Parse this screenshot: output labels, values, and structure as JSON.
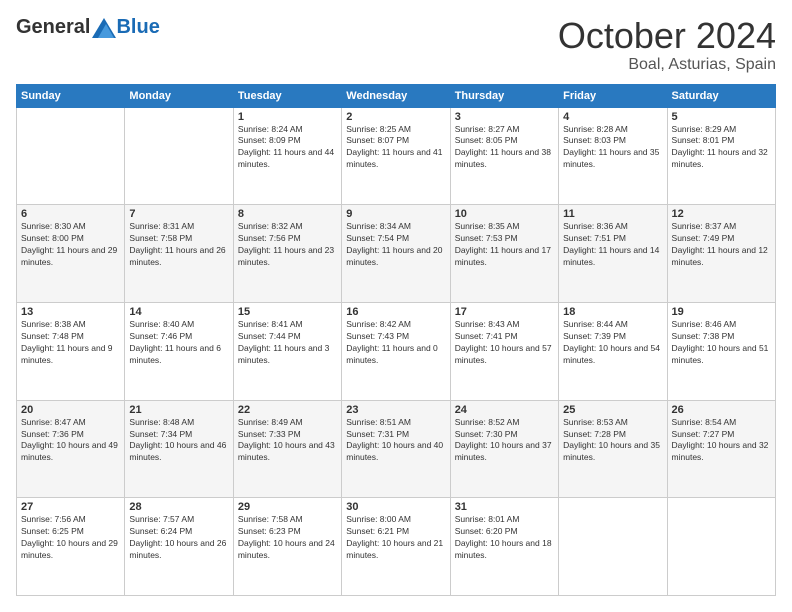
{
  "header": {
    "logo_general": "General",
    "logo_blue": "Blue",
    "month_title": "October 2024",
    "location": "Boal, Asturias, Spain"
  },
  "days_of_week": [
    "Sunday",
    "Monday",
    "Tuesday",
    "Wednesday",
    "Thursday",
    "Friday",
    "Saturday"
  ],
  "weeks": [
    [
      {
        "day": "",
        "info": ""
      },
      {
        "day": "",
        "info": ""
      },
      {
        "day": "1",
        "info": "Sunrise: 8:24 AM\nSunset: 8:09 PM\nDaylight: 11 hours and 44 minutes."
      },
      {
        "day": "2",
        "info": "Sunrise: 8:25 AM\nSunset: 8:07 PM\nDaylight: 11 hours and 41 minutes."
      },
      {
        "day": "3",
        "info": "Sunrise: 8:27 AM\nSunset: 8:05 PM\nDaylight: 11 hours and 38 minutes."
      },
      {
        "day": "4",
        "info": "Sunrise: 8:28 AM\nSunset: 8:03 PM\nDaylight: 11 hours and 35 minutes."
      },
      {
        "day": "5",
        "info": "Sunrise: 8:29 AM\nSunset: 8:01 PM\nDaylight: 11 hours and 32 minutes."
      }
    ],
    [
      {
        "day": "6",
        "info": "Sunrise: 8:30 AM\nSunset: 8:00 PM\nDaylight: 11 hours and 29 minutes."
      },
      {
        "day": "7",
        "info": "Sunrise: 8:31 AM\nSunset: 7:58 PM\nDaylight: 11 hours and 26 minutes."
      },
      {
        "day": "8",
        "info": "Sunrise: 8:32 AM\nSunset: 7:56 PM\nDaylight: 11 hours and 23 minutes."
      },
      {
        "day": "9",
        "info": "Sunrise: 8:34 AM\nSunset: 7:54 PM\nDaylight: 11 hours and 20 minutes."
      },
      {
        "day": "10",
        "info": "Sunrise: 8:35 AM\nSunset: 7:53 PM\nDaylight: 11 hours and 17 minutes."
      },
      {
        "day": "11",
        "info": "Sunrise: 8:36 AM\nSunset: 7:51 PM\nDaylight: 11 hours and 14 minutes."
      },
      {
        "day": "12",
        "info": "Sunrise: 8:37 AM\nSunset: 7:49 PM\nDaylight: 11 hours and 12 minutes."
      }
    ],
    [
      {
        "day": "13",
        "info": "Sunrise: 8:38 AM\nSunset: 7:48 PM\nDaylight: 11 hours and 9 minutes."
      },
      {
        "day": "14",
        "info": "Sunrise: 8:40 AM\nSunset: 7:46 PM\nDaylight: 11 hours and 6 minutes."
      },
      {
        "day": "15",
        "info": "Sunrise: 8:41 AM\nSunset: 7:44 PM\nDaylight: 11 hours and 3 minutes."
      },
      {
        "day": "16",
        "info": "Sunrise: 8:42 AM\nSunset: 7:43 PM\nDaylight: 11 hours and 0 minutes."
      },
      {
        "day": "17",
        "info": "Sunrise: 8:43 AM\nSunset: 7:41 PM\nDaylight: 10 hours and 57 minutes."
      },
      {
        "day": "18",
        "info": "Sunrise: 8:44 AM\nSunset: 7:39 PM\nDaylight: 10 hours and 54 minutes."
      },
      {
        "day": "19",
        "info": "Sunrise: 8:46 AM\nSunset: 7:38 PM\nDaylight: 10 hours and 51 minutes."
      }
    ],
    [
      {
        "day": "20",
        "info": "Sunrise: 8:47 AM\nSunset: 7:36 PM\nDaylight: 10 hours and 49 minutes."
      },
      {
        "day": "21",
        "info": "Sunrise: 8:48 AM\nSunset: 7:34 PM\nDaylight: 10 hours and 46 minutes."
      },
      {
        "day": "22",
        "info": "Sunrise: 8:49 AM\nSunset: 7:33 PM\nDaylight: 10 hours and 43 minutes."
      },
      {
        "day": "23",
        "info": "Sunrise: 8:51 AM\nSunset: 7:31 PM\nDaylight: 10 hours and 40 minutes."
      },
      {
        "day": "24",
        "info": "Sunrise: 8:52 AM\nSunset: 7:30 PM\nDaylight: 10 hours and 37 minutes."
      },
      {
        "day": "25",
        "info": "Sunrise: 8:53 AM\nSunset: 7:28 PM\nDaylight: 10 hours and 35 minutes."
      },
      {
        "day": "26",
        "info": "Sunrise: 8:54 AM\nSunset: 7:27 PM\nDaylight: 10 hours and 32 minutes."
      }
    ],
    [
      {
        "day": "27",
        "info": "Sunrise: 7:56 AM\nSunset: 6:25 PM\nDaylight: 10 hours and 29 minutes."
      },
      {
        "day": "28",
        "info": "Sunrise: 7:57 AM\nSunset: 6:24 PM\nDaylight: 10 hours and 26 minutes."
      },
      {
        "day": "29",
        "info": "Sunrise: 7:58 AM\nSunset: 6:23 PM\nDaylight: 10 hours and 24 minutes."
      },
      {
        "day": "30",
        "info": "Sunrise: 8:00 AM\nSunset: 6:21 PM\nDaylight: 10 hours and 21 minutes."
      },
      {
        "day": "31",
        "info": "Sunrise: 8:01 AM\nSunset: 6:20 PM\nDaylight: 10 hours and 18 minutes."
      },
      {
        "day": "",
        "info": ""
      },
      {
        "day": "",
        "info": ""
      }
    ]
  ]
}
